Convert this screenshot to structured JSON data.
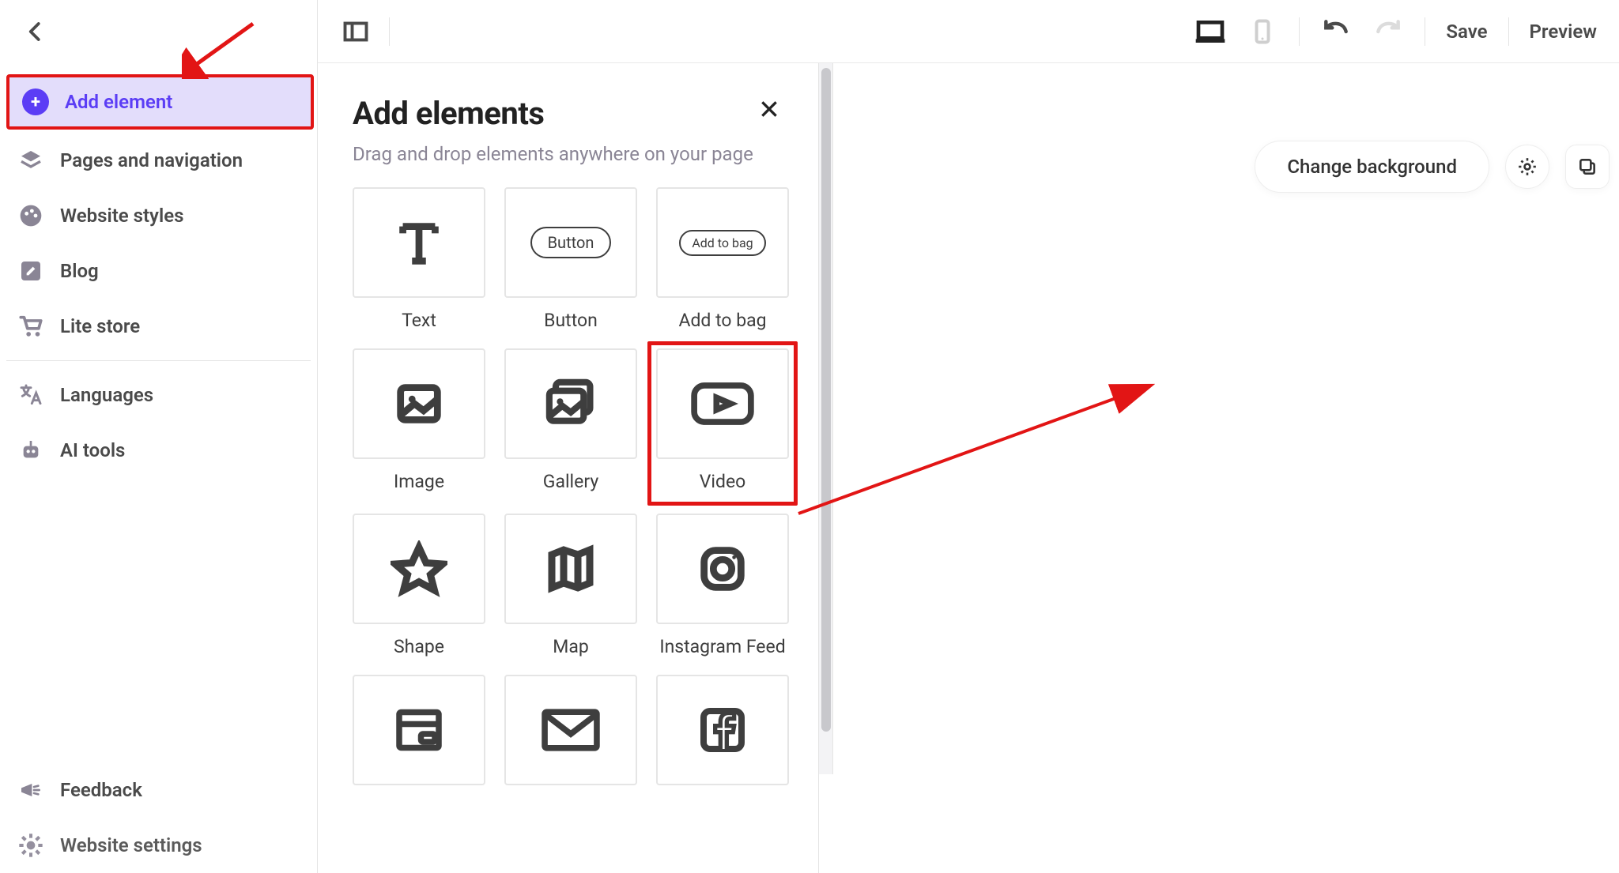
{
  "sidebar": {
    "items": [
      {
        "label": "Add element"
      },
      {
        "label": "Pages and navigation"
      },
      {
        "label": "Website styles"
      },
      {
        "label": "Blog"
      },
      {
        "label": "Lite store"
      },
      {
        "label": "Languages"
      },
      {
        "label": "AI tools"
      }
    ],
    "bottom": [
      {
        "label": "Feedback"
      },
      {
        "label": "Website settings"
      }
    ]
  },
  "topbar": {
    "save_label": "Save",
    "preview_label": "Preview"
  },
  "panel": {
    "title": "Add elements",
    "subtitle": "Drag and drop elements anywhere on your page",
    "tiles": [
      {
        "label": "Text"
      },
      {
        "label": "Button",
        "pill": "Button"
      },
      {
        "label": "Add to bag",
        "pill": "Add to bag"
      },
      {
        "label": "Image"
      },
      {
        "label": "Gallery"
      },
      {
        "label": "Video"
      },
      {
        "label": "Shape"
      },
      {
        "label": "Map"
      },
      {
        "label": "Instagram Feed"
      },
      {
        "label": ""
      },
      {
        "label": ""
      },
      {
        "label": ""
      }
    ]
  },
  "canvas": {
    "change_background_label": "Change background"
  }
}
